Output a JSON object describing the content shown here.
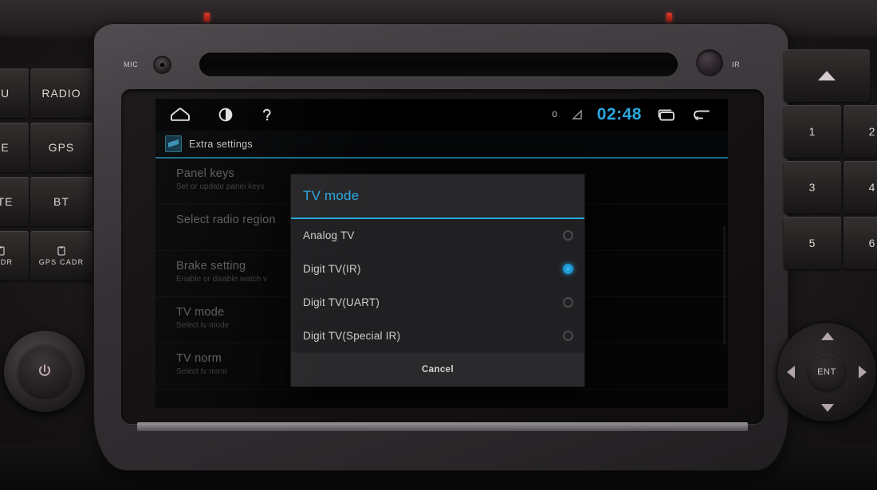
{
  "device": {
    "mic_label": "MIC",
    "ir_label": "IR"
  },
  "left_buttons": [
    {
      "label": "NU",
      "name": "menu-button"
    },
    {
      "label": "RADIO",
      "name": "radio-button"
    },
    {
      "label": "DE",
      "name": "mode-button"
    },
    {
      "label": "GPS",
      "name": "gps-button"
    },
    {
      "label": "UTE",
      "name": "mute-button"
    },
    {
      "label": "BT",
      "name": "bluetooth-button"
    },
    {
      "label": "CADR",
      "name": "cadr-button"
    },
    {
      "label": "GPS CADR",
      "name": "gps-cadr-button"
    }
  ],
  "right_buttons": [
    {
      "label": "1",
      "name": "keypad-1-button"
    },
    {
      "label": "2",
      "name": "keypad-2-button"
    },
    {
      "label": "3",
      "name": "keypad-3-button"
    },
    {
      "label": "4",
      "name": "keypad-4-button"
    },
    {
      "label": "5",
      "name": "keypad-5-button"
    },
    {
      "label": "6",
      "name": "keypad-6-button"
    }
  ],
  "dpad": {
    "center_label": "ENT"
  },
  "statusbar": {
    "home_icon": "home-icon",
    "brightness_icon": "brightness-icon",
    "help_icon": "help-icon",
    "notification_count": "0",
    "signal_icon": "signal-icon",
    "clock": "02:48",
    "recents_icon": "recent-apps-icon",
    "back_icon": "back-icon"
  },
  "screen": {
    "page_title": "Extra settings",
    "title_icon": "extra-settings-icon"
  },
  "settings_list": [
    {
      "title": "Panel keys",
      "subtitle": "Set or update panel keys"
    },
    {
      "title": "Select radio region",
      "subtitle": ""
    },
    {
      "title": "Brake setting",
      "subtitle": "Enable or disable watch v"
    },
    {
      "title": "TV mode",
      "subtitle": "Select tv mode"
    },
    {
      "title": "TV norm",
      "subtitle": "Select tv norm"
    }
  ],
  "dialog": {
    "title": "TV mode",
    "options": [
      {
        "label": "Analog TV",
        "selected": false
      },
      {
        "label": "Digit TV(IR)",
        "selected": true
      },
      {
        "label": "Digit TV(UART)",
        "selected": false
      },
      {
        "label": "Digit TV(Special IR)",
        "selected": false
      }
    ],
    "cancel_label": "Cancel"
  },
  "colors": {
    "accent": "#2aa8e0",
    "dialog_bg": "#272729",
    "option_bg": "#202022",
    "screen_bg": "#0a0a0b"
  }
}
